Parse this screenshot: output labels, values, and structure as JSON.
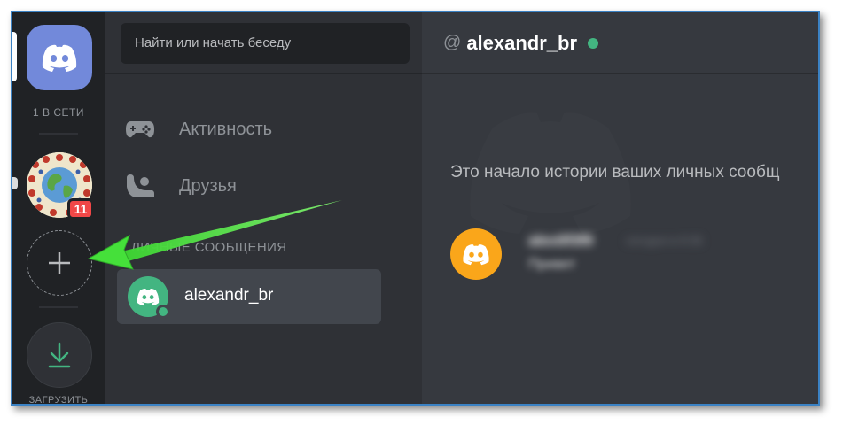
{
  "colors": {
    "blurple": "#7289da",
    "online_green": "#43b581",
    "badge_red": "#f04747",
    "avatar_orange": "#faa61a",
    "annotation_arrow": "#45e03a"
  },
  "rail": {
    "online_count": "1 В СЕТИ",
    "server_badge": "11",
    "download_label": "ЗАГРУЗИТЬ"
  },
  "sidebar": {
    "search_placeholder": "Найти или начать беседу",
    "nav": [
      {
        "label": "Активность",
        "icon": "gamepad-icon"
      },
      {
        "label": "Друзья",
        "icon": "friends-icon"
      }
    ],
    "dm_header": "ЛИЧНЫЕ СООБЩЕНИЯ",
    "dms": [
      {
        "name": "alexandr_br",
        "status": "online"
      }
    ]
  },
  "main": {
    "at_symbol": "@",
    "channel_name": "alexandr_br",
    "intro": "Это начало истории ваших личных сообщ",
    "message": {
      "author": "alex0f3f9",
      "time": "сегодня в 8:36",
      "text": "Привет"
    }
  }
}
